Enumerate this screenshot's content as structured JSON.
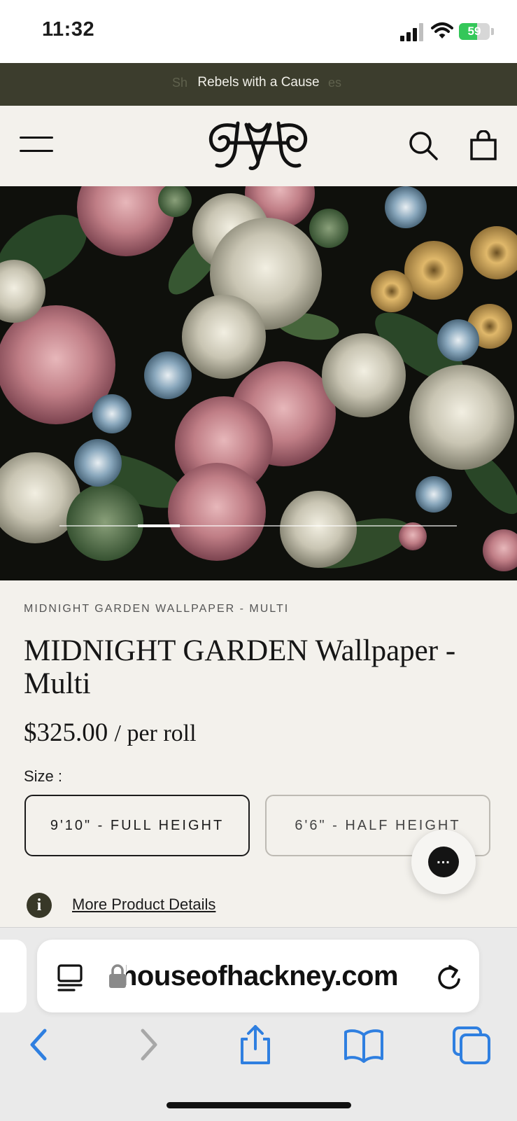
{
  "status_bar": {
    "time": "11:32",
    "battery": "59",
    "battery_level": 0.59,
    "icons": [
      "cellular-signal-icon",
      "wifi-icon",
      "battery-charging-icon"
    ]
  },
  "announcement": {
    "text": "Rebels with a Cause",
    "ghost_left": "Sh",
    "ghost_right": "es"
  },
  "header": {
    "icons": [
      "menu-icon",
      "brand-logo",
      "search-icon",
      "shopping-bag-icon"
    ]
  },
  "hero": {
    "image": "midnight-garden-floral-wallpaper",
    "slide_progress": 0.22
  },
  "product": {
    "breadcrumb": "MIDNIGHT GARDEN WALLPAPER - MULTI",
    "title": "MIDNIGHT GARDEN Wallpaper - Multi",
    "price": "$325.00",
    "price_unit": "/ per roll",
    "size_label": "Size :",
    "sizes": [
      {
        "label": "9'10\" - FULL HEIGHT",
        "selected": true
      },
      {
        "label": "6'6\" - HALF HEIGHT",
        "selected": false
      }
    ],
    "details_link": "More Product Details"
  },
  "chat": {
    "label": "..."
  },
  "browser": {
    "url": "houseofhackney.com",
    "icons": [
      "reader-icon",
      "lock-icon",
      "reload-icon",
      "back-icon",
      "forward-icon",
      "share-icon",
      "bookmarks-icon",
      "tabs-icon"
    ],
    "accent": "#2f7fe0"
  },
  "colors": {
    "announcement_bg": "#3c3d2d",
    "page_bg": "#f3f1ec",
    "info_icon_bg": "#383828"
  }
}
